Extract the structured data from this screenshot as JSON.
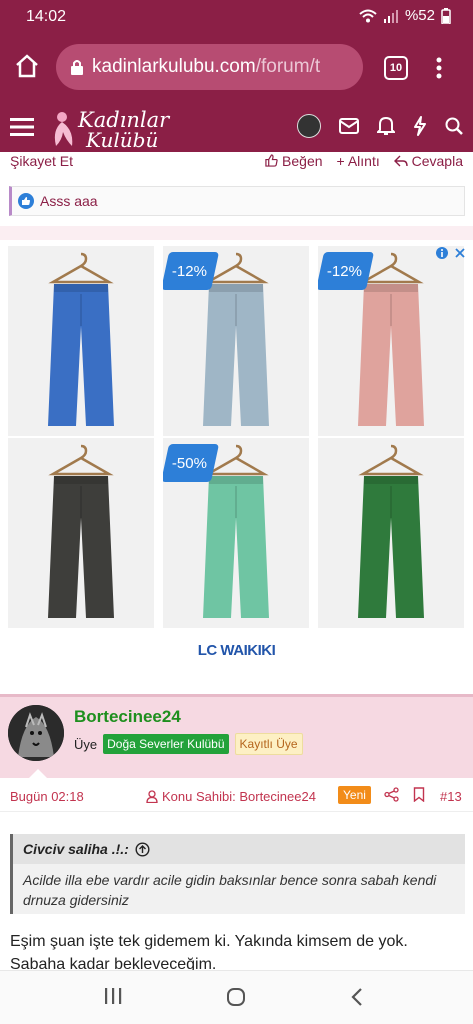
{
  "status_bar": {
    "time": "14:02",
    "battery": "%52"
  },
  "browser": {
    "url_domain": "kadinlarkulubu.com",
    "url_path": "/forum/t",
    "tab_count": "10"
  },
  "site": {
    "logo_line1": "Kadınlar",
    "logo_line2": "Kulübü"
  },
  "post_actions": {
    "report": "Şikayet Et",
    "like": "Beğen",
    "quote": "+ Alıntı",
    "reply": "Cevapla"
  },
  "likes": {
    "names": "Asss aaa"
  },
  "ad": {
    "brand": "LC WAIKIKI",
    "products": [
      {
        "color": "#3a6fc4",
        "discount": ""
      },
      {
        "color": "#9fb6c6",
        "discount": "-12%"
      },
      {
        "color": "#dfa39d",
        "discount": "-12%"
      },
      {
        "color": "#3e3e3b",
        "discount": ""
      },
      {
        "color": "#6fc5a3",
        "discount": "-50%"
      },
      {
        "color": "#2f7a3c",
        "discount": ""
      }
    ]
  },
  "post": {
    "username": "Bortecinee24",
    "role": "Üye",
    "club_tag": "Doğa Severler Kulübü",
    "status_tag": "Kayıtlı Üye",
    "date": "Bugün 02:18",
    "owner_label": "Konu Sahibi: Bortecinee24",
    "new_badge": "Yeni",
    "post_number": "#13",
    "quote_author": "Civciv saliha .!.:",
    "quote_text": "Acilde illa ebe vardır acile gidin baksınlar bence sonra sabah kendi drnuza gidersiniz",
    "body": "Eşim şuan işte tek gidemem ki. Yakında kimsem de yok. Sabaha kadar bekleveceğim."
  }
}
